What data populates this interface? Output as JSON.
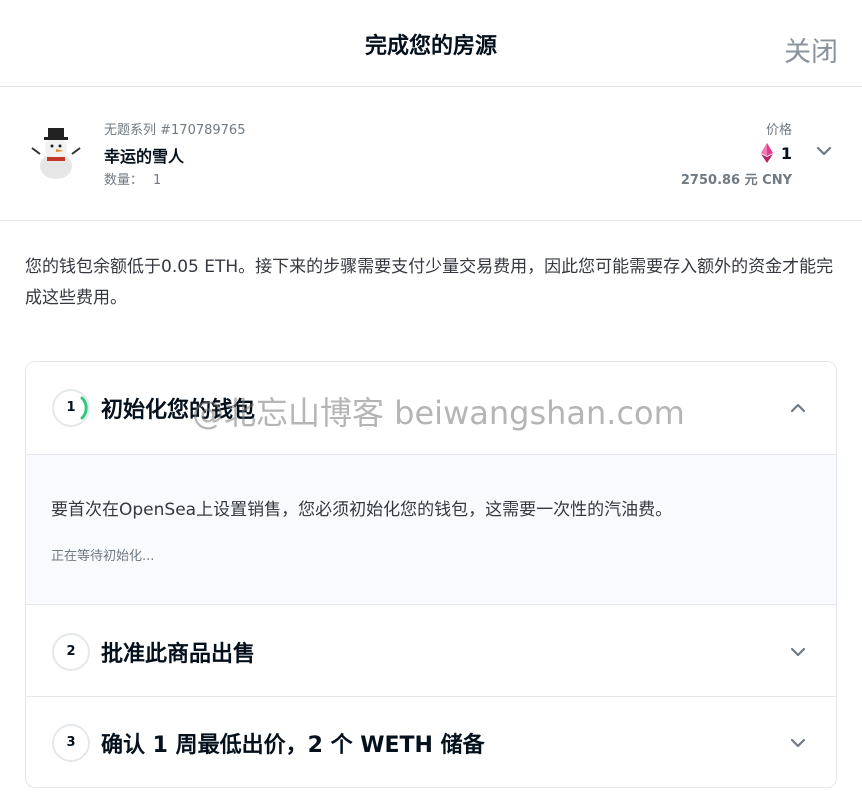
{
  "header": {
    "title": "完成您的房源",
    "close_label": "关闭"
  },
  "item": {
    "collection": "无题系列 #170789765",
    "name": "幸运的雪人",
    "quantity_label": "数量：",
    "quantity_value": "1",
    "price_label": "价格",
    "price_eth": "1",
    "price_fiat": "2750.86 元 CNY",
    "eth_icon": "ethereum-icon",
    "image": "snowman-icon"
  },
  "notice": "您的钱包余额低于0.05 ETH。接下来的步骤需要支付少量交易费用，因此您可能需要存入额外的资金才能完成这些费用。",
  "steps": [
    {
      "number": "1",
      "title": "初始化您的钱包",
      "description": "要首次在OpenSea上设置销售，您必须初始化您的钱包，这需要一次性的汽油费。",
      "status": "正在等待初始化..."
    },
    {
      "number": "2",
      "title": "批准此商品出售"
    },
    {
      "number": "3",
      "title": "确认 1 周最低出价，2 个 WETH 储备"
    }
  ],
  "watermark": "@北忘山博客 beiwangshan.com",
  "colors": {
    "accent_spinner": "#34c77b",
    "eth_pink": "#e23b87",
    "border": "#e5e8eb",
    "muted_text": "#707a83"
  }
}
